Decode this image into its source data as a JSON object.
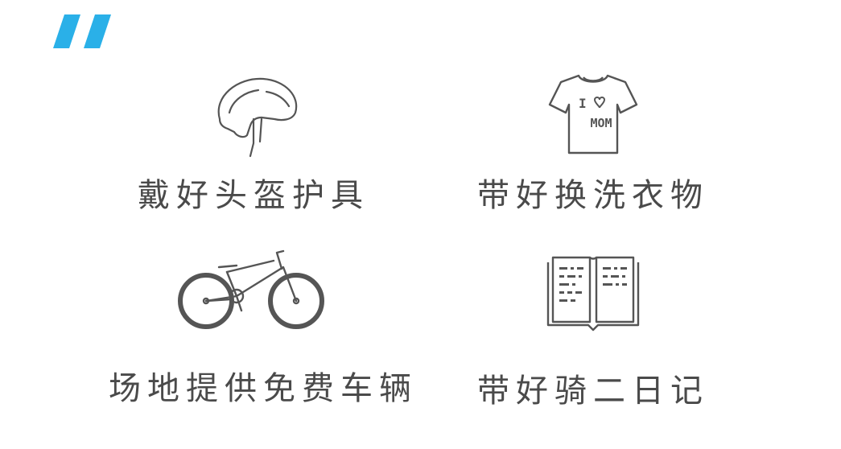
{
  "quote": {
    "icon": "quote-mark-icon",
    "color": "#2ab0e8"
  },
  "items": [
    {
      "icon": "helmet-icon",
      "label": "戴好头盔护具"
    },
    {
      "icon": "tshirt-icon",
      "label": "带好换洗衣物",
      "icon_text": "I ♡ MOM"
    },
    {
      "icon": "bicycle-icon",
      "label": "场地提供免费车辆"
    },
    {
      "icon": "open-book-icon",
      "label": "带好骑二日记"
    }
  ],
  "colors": {
    "icon_stroke": "#555555",
    "label_text": "#4a4a4a"
  }
}
